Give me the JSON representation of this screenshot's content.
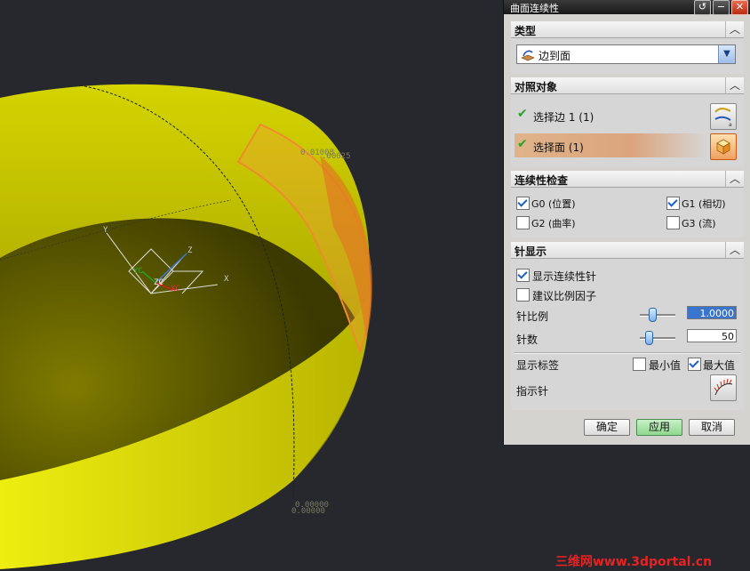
{
  "window": {
    "title": "曲面连续性",
    "btn_help": "↺",
    "btn_min": "−",
    "btn_close": "✕"
  },
  "type_section": {
    "header": "类型",
    "selected": "边到面"
  },
  "target_section": {
    "header": "对照对象",
    "rows": [
      {
        "label": "选择边 1 (1)"
      },
      {
        "label": "选择面 (1)"
      }
    ]
  },
  "continuity_section": {
    "header": "连续性检查",
    "options": [
      {
        "label": "G0 (位置)",
        "checked": true
      },
      {
        "label": "G1 (相切)",
        "checked": true
      },
      {
        "label": "G2 (曲率)",
        "checked": false
      },
      {
        "label": "G3 (流)",
        "checked": false
      }
    ]
  },
  "needle_section": {
    "header": "针显示",
    "show_needles": {
      "label": "显示连续性针",
      "checked": true
    },
    "suggest_scale": {
      "label": "建议比例因子",
      "checked": false
    },
    "scale_label": "针比例",
    "scale_value": "1.0000",
    "count_label": "针数",
    "count_value": "50",
    "show_labels": "显示标签",
    "min_label": {
      "label": "最小值",
      "checked": false
    },
    "max_label": {
      "label": "最大值",
      "checked": true
    },
    "indicator_label": "指示针"
  },
  "footer": {
    "ok": "确定",
    "apply": "应用",
    "cancel": "取消"
  },
  "viewport": {
    "label_top": "0.01008",
    "label_top2": ".00025",
    "label_bottom": "0.00000",
    "label_bottom2": "0.00000",
    "axis_x": "X",
    "axis_y": "Y",
    "axis_z": "Z",
    "axis_zc": "ZC",
    "axis_xc": "XC",
    "axis_yc": "YC"
  },
  "watermark": "三维网www.3dportal.cn",
  "colors": {
    "background": "#26282d",
    "surface": "#e6e000",
    "highlight": "#f09a3c",
    "accent": "#3b74cc"
  }
}
